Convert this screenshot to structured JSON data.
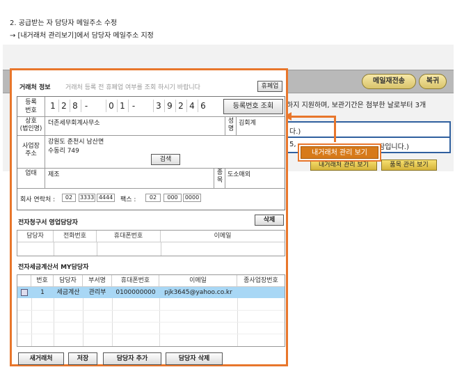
{
  "page": {
    "heading": "2. 공급받는 자 담당자 메일주소 수정",
    "subheading": "→ [내거래처 관리보기]에서 담당자 메일주소 지정"
  },
  "background": {
    "buttons": {
      "resend": "메일재전송",
      "copy": "복귀"
    },
    "notice": "하지 지원하며, 보관기간은 첨부한 날로부터 3개",
    "row1_text": "다.)",
    "row2_text": "5,",
    "row2_tail": "잠입니다.)",
    "tabs": {
      "client_manage": "내거래처 관리 보기",
      "item_manage": "품목 관리 보기"
    },
    "callout": "내거래처 관리 보기",
    "colors": {
      "accent": "#e8762b",
      "tab_gold": "#d5b43a",
      "row_border": "#2f5f9e"
    }
  },
  "dialog": {
    "client_info": {
      "title": "거래처 정보",
      "hint": "거래처 등록 전 휴폐업 여부를 조회 하시기 바랍니다",
      "closure_btn": "휴폐업",
      "reg_label": "등록\n번호",
      "reg_digits": [
        "1",
        "2",
        "8",
        "-",
        "0",
        "1",
        "-",
        "3",
        "9",
        "2",
        "4",
        "6"
      ],
      "reg_lookup_btn": "등록번호 조회",
      "company_label": "상호\n(법인명)",
      "company_value": "더존세무회계사무소",
      "name_label": "성\n명",
      "name_value": "김회계",
      "address_label": "사업장\n주소",
      "address_line1": "강원도 춘천시 남산면",
      "address_line2": "수동리 749",
      "search_btn": "검색",
      "business_label": "업태",
      "business_value": "제조",
      "type_label": "종\n목",
      "type_value": "도소매외",
      "contact_label": "회사 연락처 :",
      "phone": [
        "02",
        "3333",
        "4444"
      ],
      "fax_label": "팩스 :",
      "fax": [
        "02",
        "000",
        "0000"
      ]
    },
    "sales_contact": {
      "title": "전자청구서 영업담당자",
      "delete_btn": "삭제",
      "columns": [
        "담당자",
        "전화번호",
        "휴대폰번호",
        "이메일"
      ]
    },
    "my_contact": {
      "title": "전자세금계산서 MY담당자",
      "columns": [
        "번호",
        "담당자",
        "부서명",
        "휴대폰번호",
        "이메일",
        "종사업장번호"
      ],
      "rows": [
        {
          "no": "1",
          "name": "세금계산",
          "dept": "관리부",
          "mobile": "0100000000",
          "email": "pjk3645@yahoo.co.kr",
          "branch": ""
        }
      ]
    },
    "buttons": {
      "new_client": "새거래처",
      "save": "저장",
      "add_contact": "담당자 추가",
      "delete_contact": "담당자 삭제"
    }
  }
}
